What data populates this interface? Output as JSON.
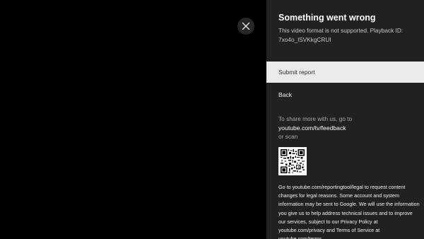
{
  "player": {
    "close_icon": "close-icon"
  },
  "dialog": {
    "title": "Something went wrong",
    "message": "This video format is not supported. Playback ID: 7xo4o_lSVKkgCRUI",
    "actions": [
      {
        "label": "Submit report",
        "selected": true
      },
      {
        "label": "Back",
        "selected": false
      }
    ],
    "share_intro": "To share more with us, go to",
    "share_url": "youtube.com/tv/feedback",
    "share_or": "or scan",
    "qr_icon": "qr-code-icon",
    "legal_text": "Go to youtube.com/reportingtool/legal to request content changes for legal reasons. Some account and system information may be sent to Google. We will use the information you give us to help address technical issues and to improve our services, subject to our Privacy Policy at youtube.com/privacy and Terms of Service at youtube.com/terms."
  },
  "colors": {
    "background": "#000000",
    "panel": "#212121",
    "selected_item": "#ebebeb",
    "close_button": "#262626"
  }
}
